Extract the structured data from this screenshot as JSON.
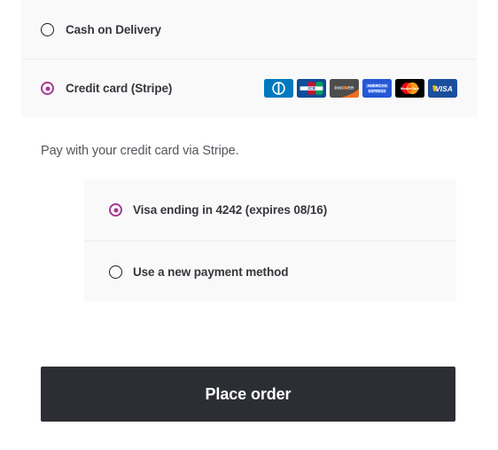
{
  "payment_methods": {
    "options": [
      {
        "label": "Cash on Delivery",
        "selected": false,
        "icon": "radio-unselected-icon"
      },
      {
        "label": "Credit card (Stripe)",
        "selected": true,
        "icon": "radio-selected-icon"
      }
    ],
    "card_brands": [
      {
        "name": "diners-club",
        "label": "Diners Club",
        "bg": "#0079BE"
      },
      {
        "name": "jcb",
        "label": "JCB",
        "bg": "#0E4C96"
      },
      {
        "name": "discover",
        "label": "DISCOVER",
        "bg": "#4D4D4D"
      },
      {
        "name": "american-express",
        "label": "AMERICAN EXPRESS",
        "bg": "#2557D6"
      },
      {
        "name": "mastercard",
        "label": "MasterCard",
        "bg": "#000000"
      },
      {
        "name": "visa",
        "label": "VISA",
        "bg": "#1A4F9C"
      }
    ]
  },
  "stripe": {
    "description": "Pay with your credit card via Stripe."
  },
  "saved_cards": {
    "options": [
      {
        "label": "Visa ending in 4242 (expires 08/16)",
        "selected": true,
        "icon": "radio-selected-icon"
      },
      {
        "label": "Use a new payment method",
        "selected": false,
        "icon": "radio-unselected-icon"
      }
    ]
  },
  "actions": {
    "place_order_label": "Place order"
  },
  "colors": {
    "accent": "#a63a90",
    "panel_bg": "#f9f9f9",
    "divider": "#ededed",
    "text": "#35373d",
    "muted_text": "#54565c",
    "button_bg": "#2c2e34"
  }
}
